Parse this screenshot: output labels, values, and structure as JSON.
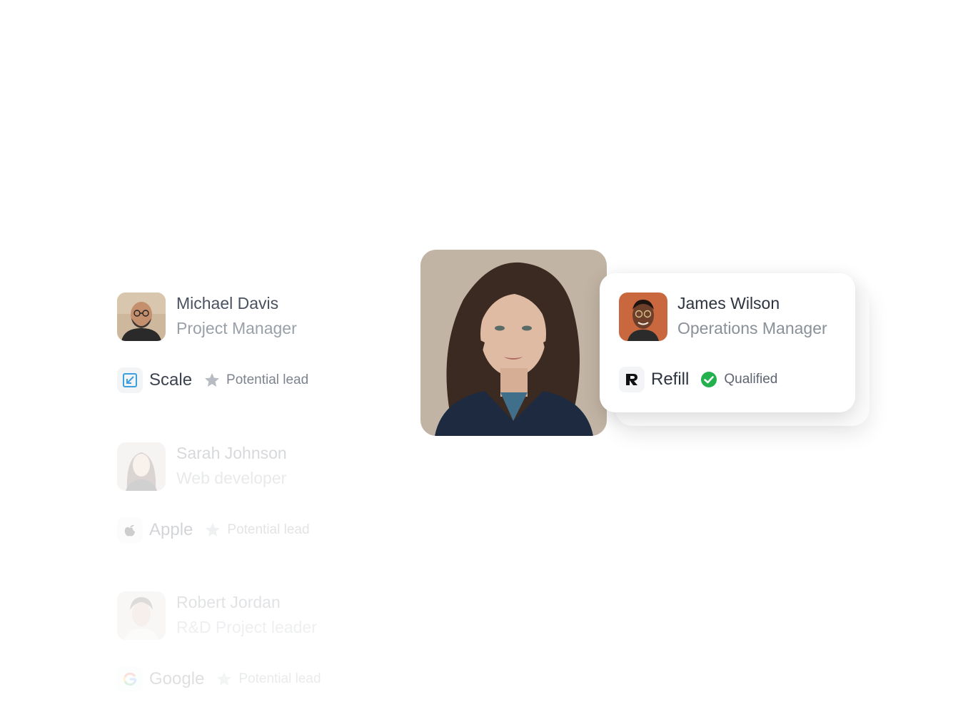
{
  "leads": [
    {
      "name": "Michael Davis",
      "role": "Project Manager",
      "company": "Scale",
      "company_logo": "scale-logo-icon",
      "status": "Potential lead",
      "status_icon": "star-icon"
    },
    {
      "name": "Sarah Johnson",
      "role": "Web developer",
      "company": "Apple",
      "company_logo": "apple-logo-icon",
      "status": "Potential lead",
      "status_icon": "star-icon"
    },
    {
      "name": "Robert Jordan",
      "role": "R&D Project leader",
      "company": "Google",
      "company_logo": "google-logo-icon",
      "status": "Potential lead",
      "status_icon": "star-icon"
    }
  ],
  "featured_card": {
    "name": "James Wilson",
    "role": "Operations Manager",
    "company": "Refill",
    "company_logo": "refill-logo-icon",
    "status": "Qualified",
    "status_icon": "check-circle-icon",
    "status_color": "#22b14c"
  },
  "colors": {
    "text_primary": "#2e3340",
    "text_secondary": "#8a9098",
    "scale_brand": "#3b9fe0",
    "star_gray": "#b8bcc2"
  }
}
